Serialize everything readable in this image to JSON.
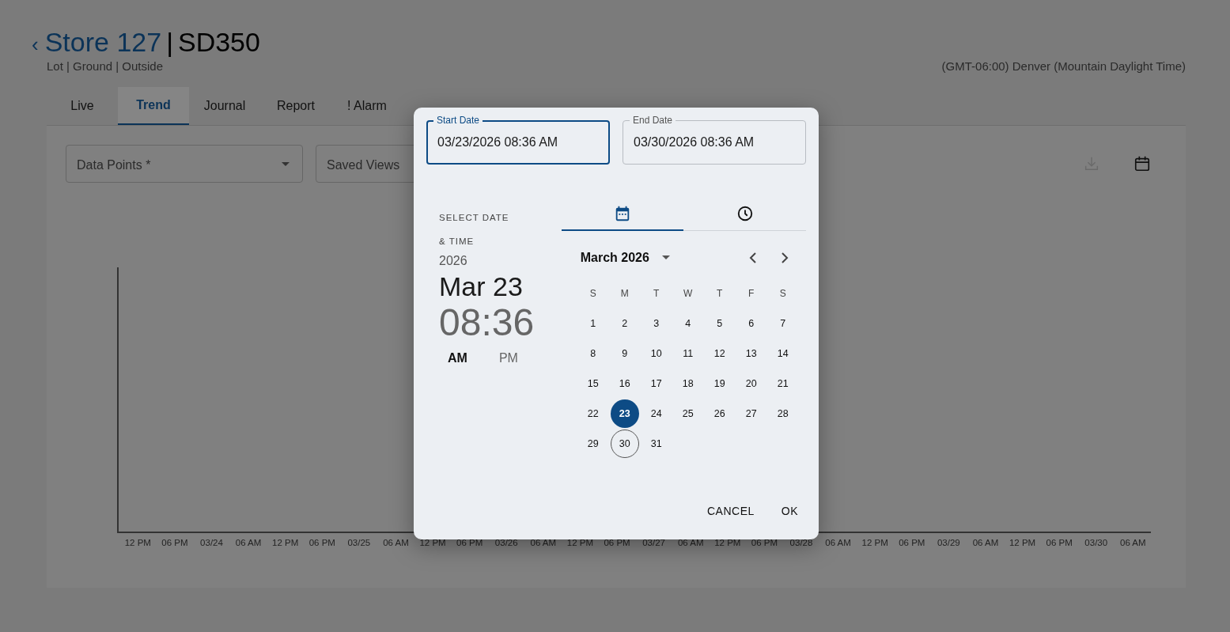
{
  "header": {
    "back": "‹",
    "site": "Store 127",
    "separator": "|",
    "device": "SD350",
    "location": "Lot | Ground | Outside",
    "timezone": "(GMT-06:00) Denver (Mountain Daylight Time)"
  },
  "tabs": [
    {
      "label": "Live",
      "selected": false
    },
    {
      "label": "Trend",
      "selected": true
    },
    {
      "label": "Journal",
      "selected": false
    },
    {
      "label": "Report",
      "selected": false
    },
    {
      "label": "! Alarm",
      "selected": false
    }
  ],
  "toolbar": {
    "data_points": {
      "label": "Data Points *"
    },
    "saved_views": {
      "label": "Saved Views"
    },
    "download_disabled": true
  },
  "chart": {
    "x_labels": [
      "12 PM",
      "06 PM",
      "03/24",
      "06 AM",
      "12 PM",
      "06 PM",
      "03/25",
      "06 AM",
      "12 PM",
      "06 PM",
      "03/26",
      "06 AM",
      "12 PM",
      "06 PM",
      "03/27",
      "06 AM",
      "12 PM",
      "06 PM",
      "03/28",
      "06 AM",
      "12 PM",
      "06 PM",
      "03/29",
      "06 AM",
      "12 PM",
      "06 PM",
      "03/30",
      "06 AM"
    ]
  },
  "dialog": {
    "fields": [
      {
        "label": "Start Date",
        "value": "03/23/2026 08:36 AM",
        "focused": true
      },
      {
        "label": "End Date",
        "value": "03/30/2026 08:36 AM",
        "focused": false
      }
    ],
    "summary": {
      "caption_1": "SELECT DATE",
      "caption_2": "& TIME",
      "year": "2026",
      "date": "Mar 23",
      "time": "08:36"
    },
    "ampm": [
      {
        "label": "AM",
        "selected": true
      },
      {
        "label": "PM",
        "selected": false
      }
    ],
    "view_tabs": [
      {
        "kind": "calendar",
        "selected": true
      },
      {
        "kind": "clock",
        "selected": false
      }
    ],
    "month": "March 2026",
    "weekdays": [
      "S",
      "M",
      "T",
      "W",
      "T",
      "F",
      "S"
    ],
    "days": [
      {
        "label": "1",
        "selected": false,
        "circled": false
      },
      {
        "label": "2",
        "selected": false,
        "circled": false
      },
      {
        "label": "3",
        "selected": false,
        "circled": false
      },
      {
        "label": "4",
        "selected": false,
        "circled": false
      },
      {
        "label": "5",
        "selected": false,
        "circled": false
      },
      {
        "label": "6",
        "selected": false,
        "circled": false
      },
      {
        "label": "7",
        "selected": false,
        "circled": false
      },
      {
        "label": "8",
        "selected": false,
        "circled": false
      },
      {
        "label": "9",
        "selected": false,
        "circled": false
      },
      {
        "label": "10",
        "selected": false,
        "circled": false
      },
      {
        "label": "11",
        "selected": false,
        "circled": false
      },
      {
        "label": "12",
        "selected": false,
        "circled": false
      },
      {
        "label": "13",
        "selected": false,
        "circled": false
      },
      {
        "label": "14",
        "selected": false,
        "circled": false
      },
      {
        "label": "15",
        "selected": false,
        "circled": false
      },
      {
        "label": "16",
        "selected": false,
        "circled": false
      },
      {
        "label": "17",
        "selected": false,
        "circled": false
      },
      {
        "label": "18",
        "selected": false,
        "circled": false
      },
      {
        "label": "19",
        "selected": false,
        "circled": false
      },
      {
        "label": "20",
        "selected": false,
        "circled": false
      },
      {
        "label": "21",
        "selected": false,
        "circled": false
      },
      {
        "label": "22",
        "selected": false,
        "circled": false
      },
      {
        "label": "23",
        "selected": true,
        "circled": false
      },
      {
        "label": "24",
        "selected": false,
        "circled": false
      },
      {
        "label": "25",
        "selected": false,
        "circled": false
      },
      {
        "label": "26",
        "selected": false,
        "circled": false
      },
      {
        "label": "27",
        "selected": false,
        "circled": false
      },
      {
        "label": "28",
        "selected": false,
        "circled": false
      },
      {
        "label": "29",
        "selected": false,
        "circled": false
      },
      {
        "label": "30",
        "selected": false,
        "circled": true
      },
      {
        "label": "31",
        "selected": false,
        "circled": false
      }
    ],
    "buttons": [
      "CANCEL",
      "OK"
    ]
  }
}
